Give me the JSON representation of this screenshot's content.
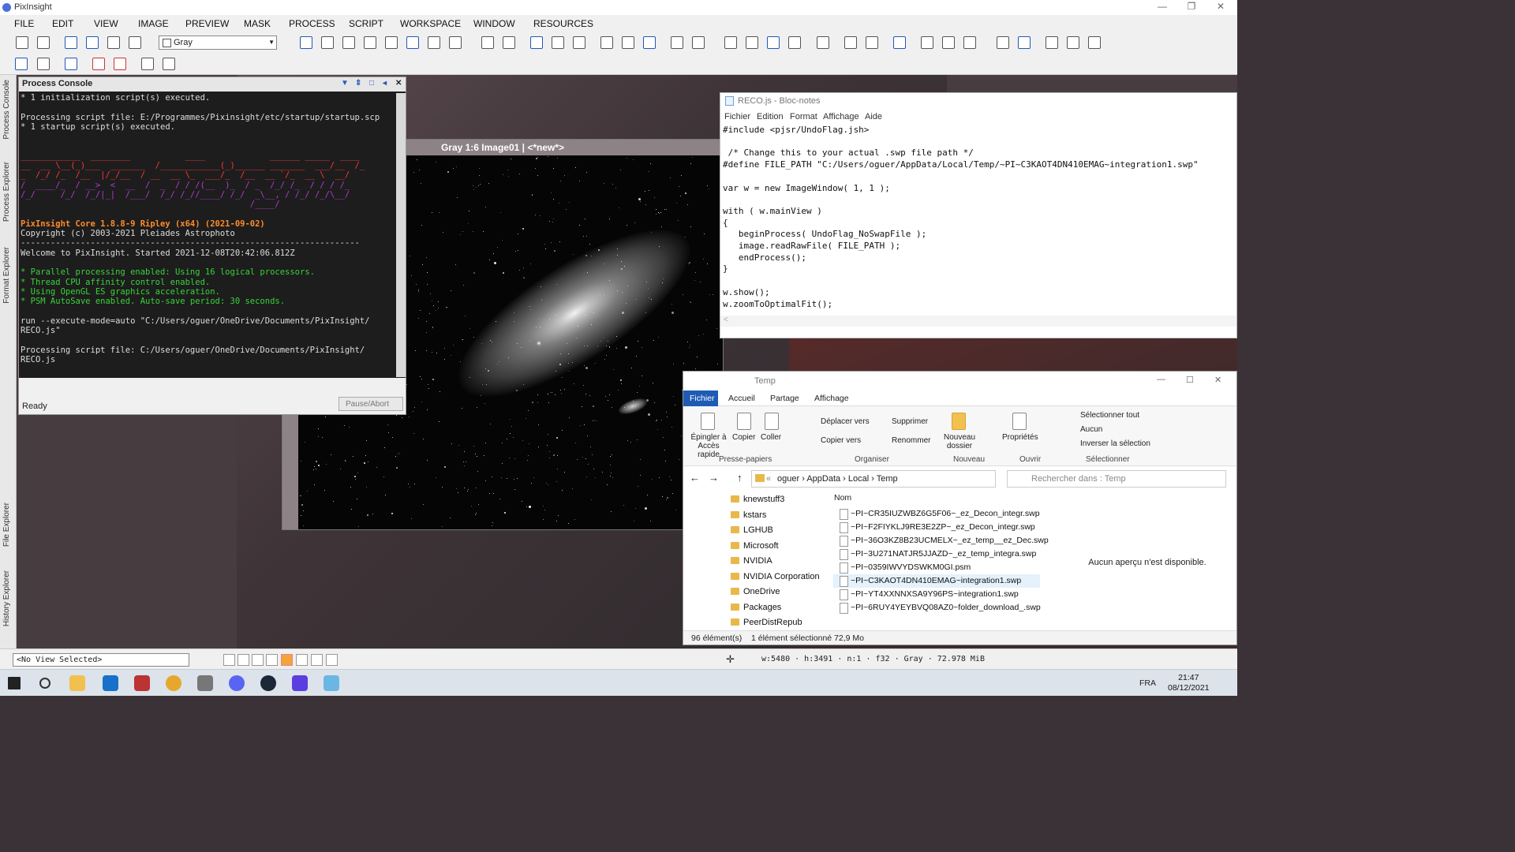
{
  "app": {
    "title": "PixInsight"
  },
  "menu": [
    "FILE",
    "EDIT",
    "VIEW",
    "IMAGE",
    "PREVIEW",
    "MASK",
    "PROCESS",
    "SCRIPT",
    "WORKSPACE",
    "WINDOW",
    "RESOURCES"
  ],
  "toolbar": {
    "view_select": "Gray"
  },
  "sidebar": {
    "tabs": [
      "Process Console",
      "Process Explorer",
      "Format Explorer",
      "File Explorer",
      "History Explorer"
    ]
  },
  "process_console": {
    "title": "Process Console",
    "lines": [
      {
        "cls": "",
        "text": "* 1 initialization script(s) executed."
      },
      {
        "cls": "",
        "text": ""
      },
      {
        "cls": "",
        "text": "Processing script file: E:/Programmes/Pixinsight/etc/startup/startup.scp"
      },
      {
        "cls": "",
        "text": "* 1 startup script(s) executed."
      },
      {
        "cls": "",
        "text": ""
      },
      {
        "cls": "",
        "text": ""
      },
      {
        "cls": "red",
        "text": "____________  ________           ____             ______ _____  ____"
      },
      {
        "cls": "red",
        "text": "__  __ \\__(_)___  _______  /____________(_)______ _______  ___/__  /_"
      },
      {
        "cls": "red",
        "text": "_  /_/ /_  /__  |/_/__  / __  __ \\_  ___/_  /__  __ `/_  __ \\  __/"
      },
      {
        "cls": "purp",
        "text": "/  ____/_  / __>  <  __  /  _  / / /(__  )_  / _  /_/ /_  / / / /_"
      },
      {
        "cls": "purp",
        "text": "/_/     /_/  /_/|_|  /___/  /_/ /_//____/ /_/  _\\__, / /_/ /_/\\__/"
      },
      {
        "cls": "purp",
        "text": "                                              /____/"
      },
      {
        "cls": "",
        "text": ""
      },
      {
        "cls": "org",
        "text": "PixInsight Core 1.8.8-9 Ripley (x64) (2021-09-02)"
      },
      {
        "cls": "",
        "text": "Copyright (c) 2003-2021 Pleiades Astrophoto"
      },
      {
        "cls": "",
        "text": "--------------------------------------------------------------------"
      },
      {
        "cls": "",
        "text": "Welcome to PixInsight. Started 2021-12-08T20:42:06.812Z"
      },
      {
        "cls": "",
        "text": ""
      },
      {
        "cls": "grn",
        "text": "* Parallel processing enabled: Using 16 logical processors."
      },
      {
        "cls": "grn",
        "text": "* Thread CPU affinity control enabled."
      },
      {
        "cls": "grn",
        "text": "* Using OpenGL ES graphics acceleration."
      },
      {
        "cls": "grn",
        "text": "* PSM AutoSave enabled. Auto-save period: 30 seconds."
      },
      {
        "cls": "",
        "text": ""
      },
      {
        "cls": "",
        "text": "run --execute-mode=auto \"C:/Users/oguer/OneDrive/Documents/PixInsight/"
      },
      {
        "cls": "",
        "text": "RECO.js\""
      },
      {
        "cls": "",
        "text": ""
      },
      {
        "cls": "",
        "text": "Processing script file: C:/Users/oguer/OneDrive/Documents/PixInsight/"
      },
      {
        "cls": "",
        "text": "RECO.js"
      }
    ],
    "status": "Ready",
    "pause_label": "Pause/Abort"
  },
  "image_window": {
    "title": "Gray 1:6 Image01 | <*new*>"
  },
  "notepad": {
    "title": "RECO.js - Bloc-notes",
    "menu": [
      "Fichier",
      "Edition",
      "Format",
      "Affichage",
      "Aide"
    ],
    "code": "#include <pjsr/UndoFlag.jsh>\n\n /* Change this to your actual .swp file path */\n#define FILE_PATH \"C:/Users/oguer/AppData/Local/Temp/~PI~C3KAOT4DN410EMAG~integration1.swp\"\n\nvar w = new ImageWindow( 1, 1 );\n\nwith ( w.mainView )\n{\n   beginProcess( UndoFlag_NoSwapFile );\n   image.readRawFile( FILE_PATH );\n   endProcess();\n}\n\nw.show();\nw.zoomToOptimalFit();",
    "scroll_glyph": "<"
  },
  "explorer": {
    "title": "Temp",
    "tabs": [
      "Fichier",
      "Accueil",
      "Partage",
      "Affichage"
    ],
    "ribbon": {
      "pin": "Épingler à Accès rapide",
      "copy": "Copier",
      "paste": "Coller",
      "group1": "Presse-papiers",
      "move": "Déplacer vers",
      "copyto": "Copier vers",
      "delete": "Supprimer",
      "rename": "Renommer",
      "group2": "Organiser",
      "newfolder": "Nouveau dossier",
      "group3": "Nouveau",
      "props": "Propriétés",
      "group4": "Ouvrir",
      "selall": "Sélectionner tout",
      "none": "Aucun",
      "invert": "Inverser la sélection",
      "group5": "Sélectionner"
    },
    "path": [
      "«",
      "oguer",
      "AppData",
      "Local",
      "Temp"
    ],
    "search_placeholder": "Rechercher dans : Temp",
    "tree": [
      "knewstuff3",
      "kstars",
      "LGHUB",
      "Microsoft",
      "NVIDIA",
      "NVIDIA Corporation",
      "OneDrive",
      "Packages",
      "PeerDistRepub"
    ],
    "col_name": "Nom",
    "files": [
      "~PI~CR35IUZWBZ6G5F06~_ez_Decon_integr.swp",
      "~PI~F2FIYKLJ9RE3E2ZP~_ez_Decon_integr.swp",
      "~PI~36O3KZ8B23UCMELX~_ez_temp__ez_Dec.swp",
      "~PI~3U271NATJR5JJAZD~_ez_temp_integra.swp",
      "~PI~0359IWVYDSWKM0GI.psm",
      "~PI~C3KAOT4DN410EMAG~integration1.swp",
      "~PI~YT4XXNNXSA9Y96PS~integration1.swp",
      "~PI~6RUY4YEYBVQ08AZ0~folder_download_.swp"
    ],
    "selected_index": 5,
    "preview": "Aucun aperçu n'est disponible.",
    "status_count": "96 élément(s)",
    "status_sel": "1 élément sélectionné  72,9 Mo"
  },
  "statusbar": {
    "view": "<No View Selected>",
    "info": "w:5480 · h:3491 · n:1 · f32 · Gray · 72.978 MiB"
  },
  "taskbar": {
    "lang": "FRA",
    "time": "21:47",
    "date": "08/12/2021"
  },
  "colors": {
    "accent": "#1e5bb5",
    "console_bg": "#1d1d1d"
  }
}
